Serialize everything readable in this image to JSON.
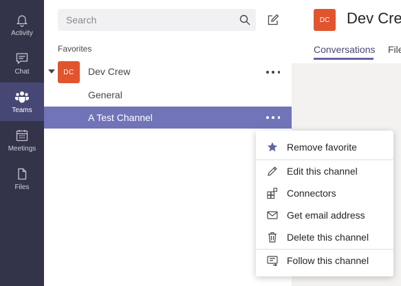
{
  "rail": {
    "items": [
      {
        "label": "Activity",
        "icon": "bell-icon"
      },
      {
        "label": "Chat",
        "icon": "chat-icon"
      },
      {
        "label": "Teams",
        "icon": "teams-icon"
      },
      {
        "label": "Meetings",
        "icon": "calendar-icon"
      },
      {
        "label": "Files",
        "icon": "file-icon"
      }
    ],
    "active": "Teams"
  },
  "panel": {
    "search_placeholder": "Search",
    "section_label": "Favorites",
    "team": {
      "avatar_initials": "DC",
      "name": "Dev Crew"
    },
    "channels": [
      "General",
      "A Test Channel"
    ],
    "selected_channel": "A Test Channel"
  },
  "content": {
    "avatar_initials": "DC",
    "title": "Dev Crew",
    "tabs": [
      "Conversations",
      "Files"
    ]
  },
  "context_menu": {
    "items": [
      {
        "label": "Remove favorite",
        "icon": "star-icon"
      },
      {
        "label": "Edit this channel",
        "icon": "pencil-icon"
      },
      {
        "label": "Connectors",
        "icon": "connectors-icon"
      },
      {
        "label": "Get email address",
        "icon": "envelope-icon"
      },
      {
        "label": "Delete this channel",
        "icon": "trash-icon"
      },
      {
        "label": "Follow this channel",
        "icon": "follow-icon"
      }
    ]
  },
  "colors": {
    "rail_bg": "#33344a",
    "rail_active": "#464775",
    "accent": "#6264a7",
    "selected_row": "#7174b8",
    "team_avatar": "#e0542e"
  }
}
